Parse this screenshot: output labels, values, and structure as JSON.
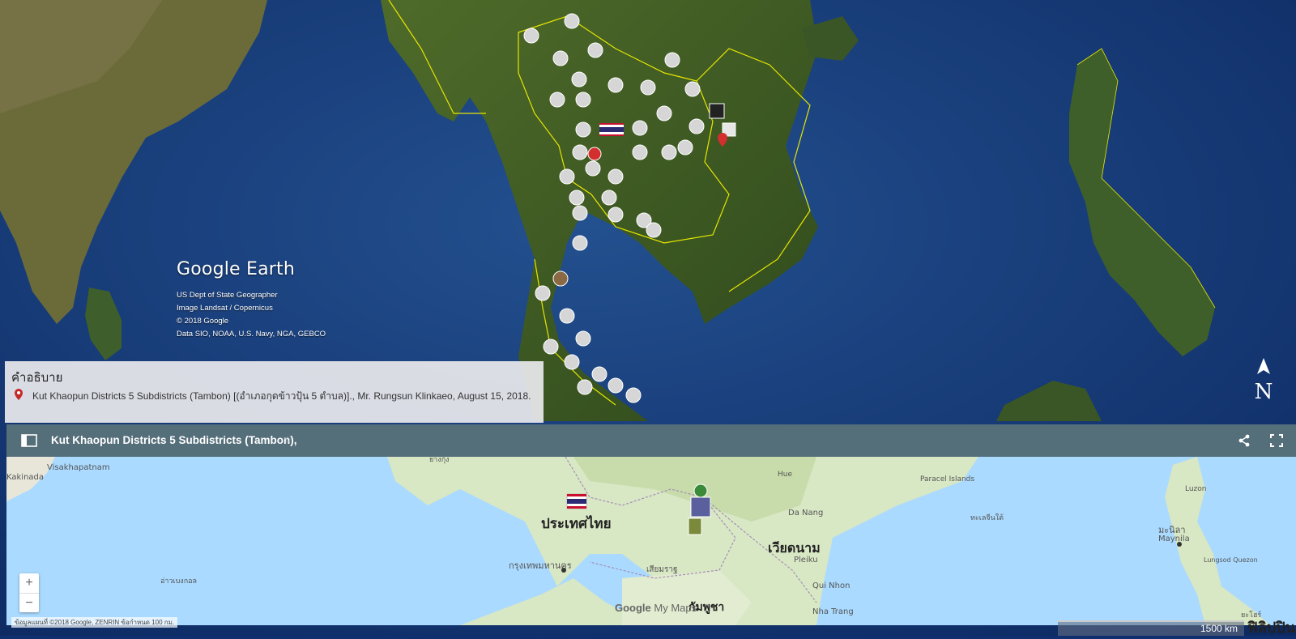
{
  "earth": {
    "logo": "Google Earth",
    "credits": [
      "US Dept of State Geographer",
      "Image Landsat / Copernicus",
      "© 2018 Google",
      "Data SIO, NOAA, U.S. Navy, NGA, GEBCO"
    ],
    "compass": "N"
  },
  "description_panel": {
    "title": "คำอธิบาย",
    "text": "Kut Khaopun Districts 5 Subdistricts (Tambon) [(อำเภอกุดข้าวปุ้น 5 ตำบล)]., Mr. Rungsun Klinkaeo, August 15, 2018."
  },
  "mymaps": {
    "title": "Kut Khaopun Districts 5 Subdistricts (Tambon),",
    "star": "☆",
    "labels": [
      {
        "text": "ประเทศไทย",
        "size": 17
      },
      {
        "text": "เวียดนาม",
        "size": 16
      },
      {
        "text": "กัมพูชา",
        "size": 14
      },
      {
        "text": "กรุงเทพมหานคร",
        "size": 11
      },
      {
        "text": "Visakhapatnam",
        "size": 10
      },
      {
        "text": "Kakinada",
        "size": 10
      },
      {
        "text": "Paracel Islands",
        "size": 9
      },
      {
        "text": "Luzon",
        "size": 9
      },
      {
        "text": "มะนิลา",
        "size": 11
      },
      {
        "text": "Maynila",
        "size": 10
      },
      {
        "text": "Da Nang",
        "size": 10
      },
      {
        "text": "Pleiku",
        "size": 10
      },
      {
        "text": "Qui Nhon",
        "size": 10
      },
      {
        "text": "Nha Trang",
        "size": 10
      },
      {
        "text": "Hue",
        "size": 9
      },
      {
        "text": "เสียมราฐ",
        "size": 10
      },
      {
        "text": "ทะเลจีนใต้",
        "size": 9
      },
      {
        "text": "อ่าวเบงกอล",
        "size": 9
      },
      {
        "text": "ย่างกุ้ง",
        "size": 9
      },
      {
        "text": "ยะโฮร์",
        "size": 9
      },
      {
        "text": "Lungsod Quezon",
        "size": 8
      }
    ],
    "zoom_in": "+",
    "zoom_out": "−",
    "attribution": "ข้อมูลแผนที่ ©2018 Google, ZENRIN   ข้อกำหนด   100 กม.",
    "google": "Google",
    "mymaps_label": "My Maps",
    "scale": "1500 km",
    "philippines": "ฟิลิปปิน"
  },
  "colors": {
    "header": "#546e7a",
    "sea_light": "#aadaff",
    "land": "#d8e7c4",
    "border_yellow": "#e6e600",
    "pin_red": "#d32f2f"
  }
}
